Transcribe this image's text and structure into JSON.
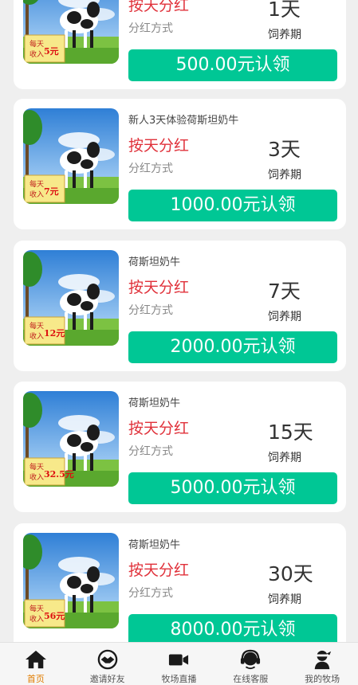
{
  "products": [
    {
      "name": "",
      "method": "按天分红",
      "method_label": "分红方式",
      "days": "1天",
      "days_label": "饲养期",
      "claim": "500.00元认领",
      "banner": "每天收入",
      "income": "5元"
    },
    {
      "name": "新人3天体验荷斯坦奶牛",
      "method": "按天分红",
      "method_label": "分红方式",
      "days": "3天",
      "days_label": "饲养期",
      "claim": "1000.00元认领",
      "banner": "每天收入",
      "income": "7元"
    },
    {
      "name": "荷斯坦奶牛",
      "method": "按天分红",
      "method_label": "分红方式",
      "days": "7天",
      "days_label": "饲养期",
      "claim": "2000.00元认领",
      "banner": "每天收入",
      "income": "12元"
    },
    {
      "name": "荷斯坦奶牛",
      "method": "按天分红",
      "method_label": "分红方式",
      "days": "15天",
      "days_label": "饲养期",
      "claim": "5000.00元认领",
      "banner": "每天收入",
      "income": "32.5元"
    },
    {
      "name": "荷斯坦奶牛",
      "method": "按天分红",
      "method_label": "分红方式",
      "days": "30天",
      "days_label": "饲养期",
      "claim": "8000.00元认领",
      "banner": "每天收入",
      "income": "56元"
    }
  ],
  "tabbar": {
    "items": [
      {
        "label": "首页",
        "icon": "home-icon",
        "active": true
      },
      {
        "label": "邀请好友",
        "icon": "handshake-icon",
        "active": false
      },
      {
        "label": "牧场直播",
        "icon": "video-camera-icon",
        "active": false
      },
      {
        "label": "在线客服",
        "icon": "headset-icon",
        "active": false
      },
      {
        "label": "我的牧场",
        "icon": "user-ninja-icon",
        "active": false
      }
    ]
  },
  "colors": {
    "accent": "#00c795",
    "method_red": "#e0313a",
    "tab_active": "#e07c00"
  }
}
